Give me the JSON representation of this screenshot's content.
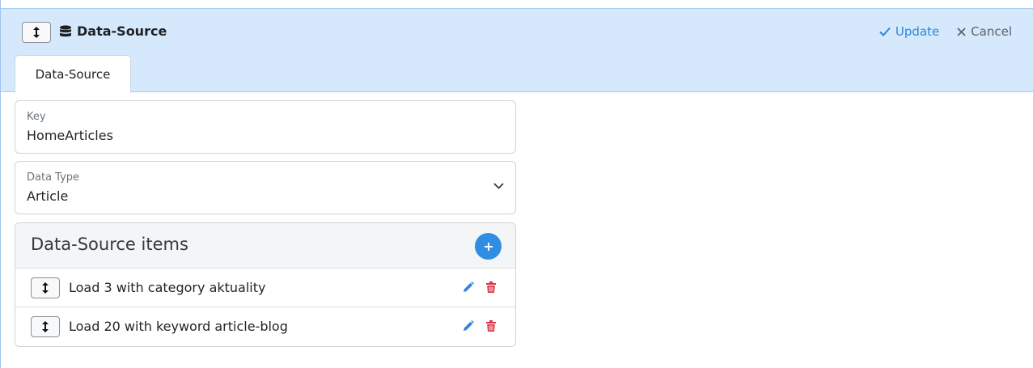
{
  "header": {
    "drag_glyph": "↕",
    "title": "Data-Source",
    "title_icon": "database-icon",
    "update_label": "Update",
    "cancel_label": "Cancel"
  },
  "tabs": [
    {
      "label": "Data-Source",
      "active": true
    }
  ],
  "form": {
    "key": {
      "label": "Key",
      "value": "HomeArticles"
    },
    "data_type": {
      "label": "Data Type",
      "value": "Article"
    }
  },
  "items_panel": {
    "title": "Data-Source items",
    "items": [
      {
        "label": "Load 3 with category aktuality"
      },
      {
        "label": "Load 20 with keyword article-blog"
      }
    ]
  },
  "colors": {
    "header_bg": "#d6e8fb",
    "accent": "#2f8de4",
    "update": "#2f86d8",
    "delete": "#dc3545"
  }
}
